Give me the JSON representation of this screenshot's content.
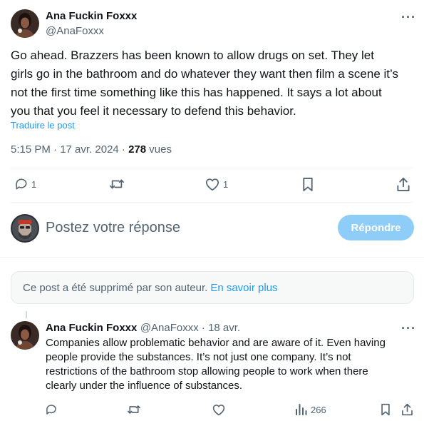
{
  "main_post": {
    "author_name": "Ana Fuckin Foxxx",
    "author_handle": "@AnaFoxxx",
    "text": "Go ahead. Brazzers has been known to allow drugs on set. They let girls go in the bathroom and do whatever they want then film a scene it’s not the first time something like this has happened. It says a lot about you that you feel it necessary to defend this behavior.",
    "translate_label": "Traduire le post",
    "timestamp": "5:15 PM · 17 avr. 2024 · ",
    "views_count": "278",
    "views_label": " vues",
    "actions": {
      "reply_count": "1",
      "like_count": "1"
    }
  },
  "composer": {
    "placeholder": "Postez votre réponse",
    "reply_button": "Répondre"
  },
  "deleted_notice": {
    "text": "Ce post a été supprimé par son auteur.",
    "link": "En savoir plus"
  },
  "reply_post": {
    "author_name": "Ana Fuckin Foxxx",
    "author_handle": "@AnaFoxxx",
    "date": " · 18 avr.",
    "text": "Companies allow problematic behavior and are aware of it. Even having people provide the substances. It’s not just one company. It’s not restrictions of the bathroom stop allowing people to work when there clearly under the influence of substances.",
    "views_count": "266"
  },
  "icons": [
    "more-icon",
    "reply-icon",
    "repost-icon",
    "like-icon",
    "bookmark-icon",
    "share-icon",
    "views-icon"
  ],
  "colors": {
    "accent": "#1d9bf0",
    "muted": "#536471",
    "button_disabled": "#8ecdf7"
  }
}
